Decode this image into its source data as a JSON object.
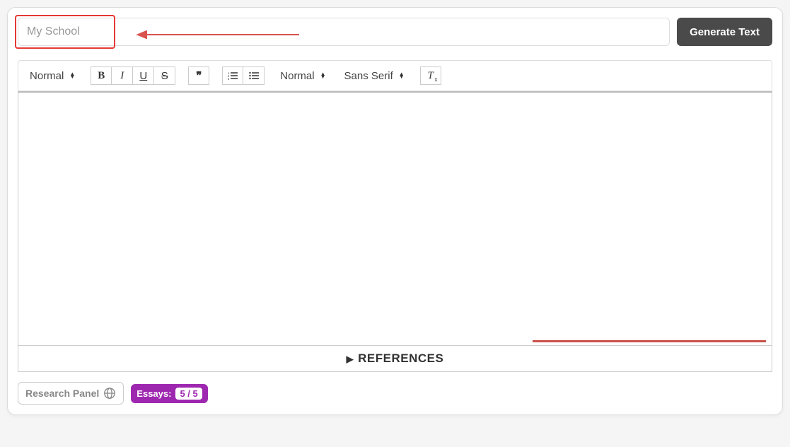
{
  "top": {
    "topic_value": "My School",
    "generate_label": "Generate Text"
  },
  "toolbar": {
    "heading_select": "Normal",
    "align_select": "Normal",
    "font_select": "Sans Serif"
  },
  "references": {
    "label": "REFERENCES"
  },
  "bottom": {
    "research_label": "Research Panel",
    "essays_label": "Essays:",
    "essays_count": "5 / 5"
  }
}
